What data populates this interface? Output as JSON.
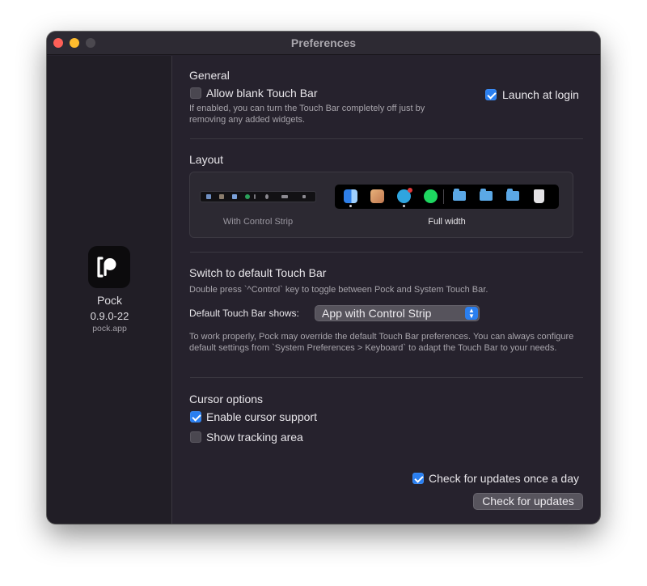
{
  "window": {
    "title": "Preferences"
  },
  "sidebar": {
    "app_name": "Pock",
    "version": "0.9.0-22",
    "site": "pock.app"
  },
  "general": {
    "heading": "General",
    "allow_blank": {
      "label": "Allow blank Touch Bar",
      "checked": false
    },
    "allow_blank_help": "If enabled, you can turn the Touch Bar completely off just by removing any added widgets.",
    "launch_at_login": {
      "label": "Launch at login",
      "checked": true
    }
  },
  "layout": {
    "heading": "Layout",
    "options": [
      {
        "caption": "With Control Strip",
        "selected": false
      },
      {
        "caption": "Full width",
        "selected": true
      }
    ]
  },
  "switch": {
    "heading": "Switch to default Touch Bar",
    "help": "Double press `^Control` key to toggle between Pock and System Touch Bar.",
    "default_label": "Default Touch Bar shows:",
    "default_value": "App with Control Strip",
    "note": "To work properly, Pock may override the default Touch Bar preferences. You can always configure default settings from `System Preferences > Keyboard` to adapt the Touch Bar to your needs."
  },
  "cursor": {
    "heading": "Cursor options",
    "enable": {
      "label": "Enable cursor support",
      "checked": true
    },
    "tracking": {
      "label": "Show tracking area",
      "checked": false
    }
  },
  "updates": {
    "daily": {
      "label": "Check for updates once a day",
      "checked": true
    },
    "button_label": "Check for updates"
  },
  "colors": {
    "accent": "#2a7ff0",
    "window_bg": "#26222d",
    "sidebar_bg": "#211e26"
  },
  "icons": {
    "app": "pock-logo-icon",
    "touchbar": [
      "finder-icon",
      "photos-icon",
      "telegram-icon",
      "spotify-icon",
      "folder-icon",
      "folder-icon",
      "downloads-folder-icon",
      "trash-icon"
    ]
  }
}
